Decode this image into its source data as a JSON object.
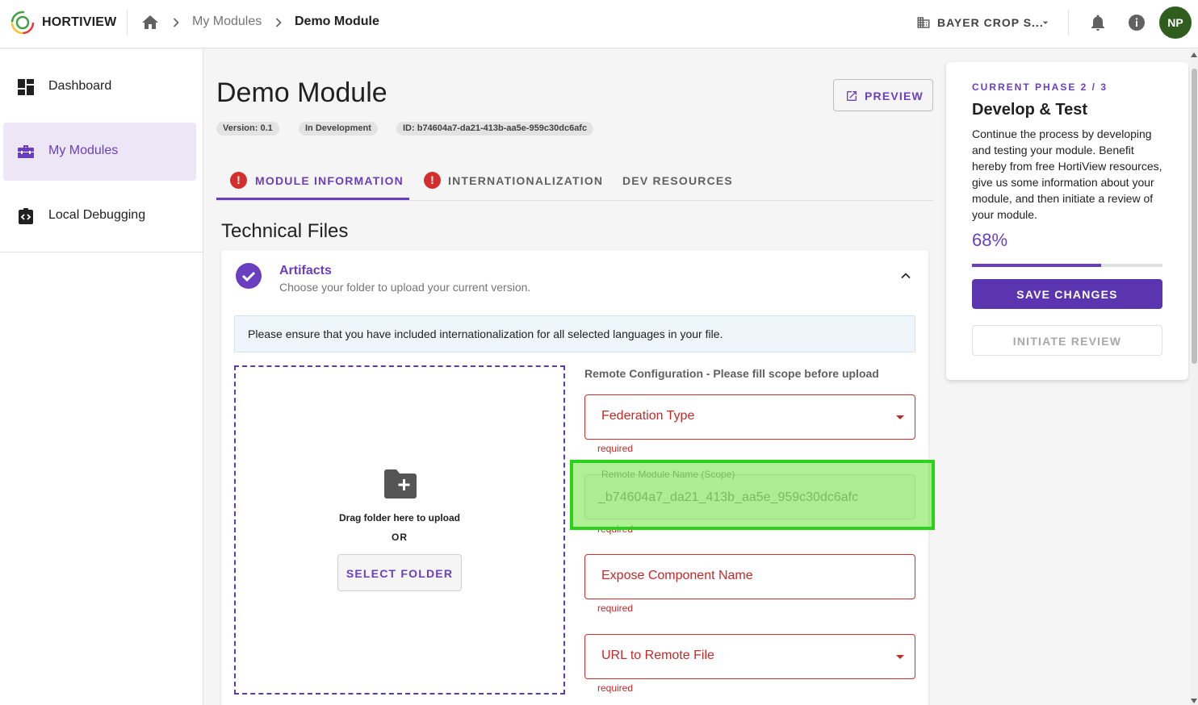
{
  "app": {
    "brand": "HORTIVIEW"
  },
  "breadcrumb": {
    "link": "My Modules",
    "current": "Demo Module"
  },
  "header": {
    "org_name": "BAYER CROP S...",
    "avatar_initials": "NP",
    "avatar_color": "#2e5d1e"
  },
  "sidebar": {
    "items": [
      {
        "label": "Dashboard",
        "icon": "dashboard-icon"
      },
      {
        "label": "My Modules",
        "icon": "toolbox-icon",
        "active": true
      },
      {
        "label": "Local Debugging",
        "icon": "code-box-icon"
      }
    ]
  },
  "page": {
    "title": "Demo Module",
    "preview_label": "PREVIEW",
    "chips": {
      "version": "Version: 0.1",
      "status": "In Development",
      "id": "ID: b74604a7-da21-413b-aa5e-959c30dc6afc"
    },
    "tabs": [
      {
        "label": "MODULE INFORMATION",
        "alert": "!",
        "active": true
      },
      {
        "label": "INTERNATIONALIZATION",
        "alert": "!"
      },
      {
        "label": "DEV RESOURCES"
      }
    ],
    "section_title": "Technical Files"
  },
  "artifacts": {
    "title": "Artifacts",
    "subtitle": "Choose your folder to upload your current version.",
    "banner": "Please ensure that you have included internationalization for all selected languages in your file.",
    "dropzone": {
      "drag_text": "Drag folder here to upload",
      "or_text": "OR",
      "select_label": "SELECT FOLDER"
    },
    "remote": {
      "title": "Remote Configuration - Please fill scope before upload",
      "federation_type": "Federation Type",
      "scope_label": "Remote Module Name (Scope)",
      "scope_value": "_b74604a7_da21_413b_aa5e_959c30dc6afc",
      "expose_component": "Expose Component Name",
      "url_remote_file": "URL to Remote File",
      "helper": "required"
    }
  },
  "phase": {
    "label": "CURRENT PHASE 2 / 3",
    "title": "Develop & Test",
    "description": "Continue the process by developing and testing your module. Benefit hereby from free HortiView resources, give us some information about your module, and then initiate a review of your module.",
    "progress_text": "68%",
    "progress_value": 0.68,
    "save_label": "SAVE CHANGES",
    "review_label": "INITIATE REVIEW"
  },
  "colors": {
    "accent": "#6a3fbf",
    "error": "#d32f2f",
    "highlight": "#2ad31a"
  }
}
